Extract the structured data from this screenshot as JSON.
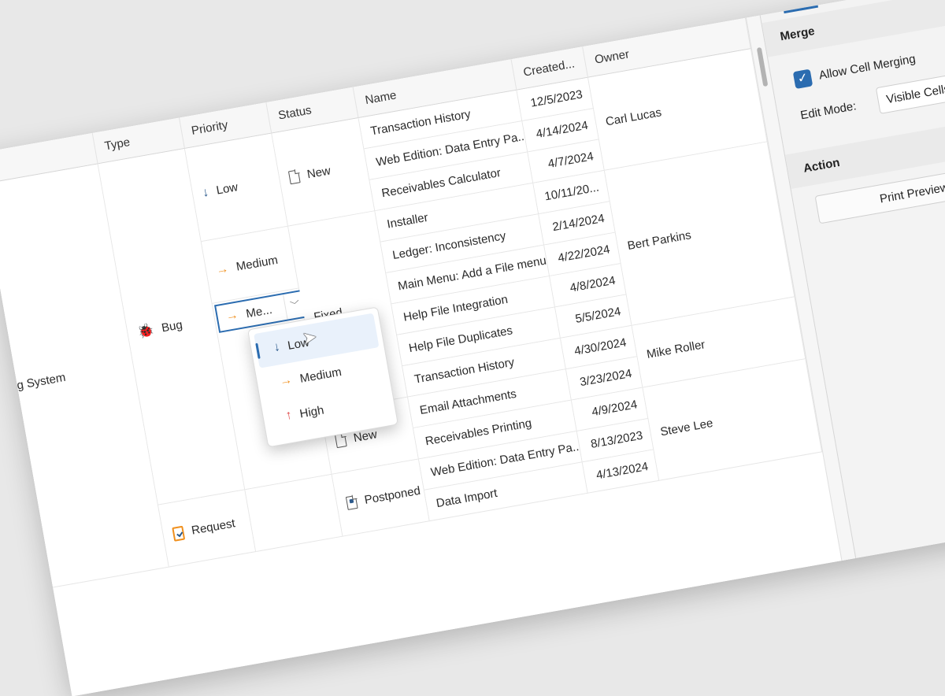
{
  "columns": {
    "project": "",
    "type": "Type",
    "priority": "Priority",
    "status": "Status",
    "name": "Name",
    "created": "Created...",
    "owner": "Owner"
  },
  "project_value": "Enterprise Accounting System",
  "types": {
    "bug": "Bug",
    "request": "Request"
  },
  "priority_labels": {
    "low": "Low",
    "medium": "Medium",
    "editor": "Me..."
  },
  "status_labels": {
    "new1": "New",
    "fixed": "Fixed",
    "new2": "New",
    "postponed": "Postponed"
  },
  "rows": [
    {
      "name": "Transaction History",
      "date": "12/5/2023"
    },
    {
      "name": "Web Edition: Data Entry Pa...",
      "date": "4/14/2024"
    },
    {
      "name": "Receivables Calculator",
      "date": "4/7/2024"
    },
    {
      "name": "Installer",
      "date": "10/11/20..."
    },
    {
      "name": "Ledger: Inconsistency",
      "date": "2/14/2024"
    },
    {
      "name": "Main Menu: Add a File menu",
      "date": "4/22/2024"
    },
    {
      "name": "Help File Integration",
      "date": "4/8/2024"
    },
    {
      "name": "Help File Duplicates",
      "date": "5/5/2024"
    },
    {
      "name": "Transaction History",
      "date": "4/30/2024"
    },
    {
      "name": "Email Attachments",
      "date": "3/23/2024"
    },
    {
      "name": "Receivables Printing",
      "date": "4/9/2024"
    },
    {
      "name": "Web Edition: Data Entry Pa...",
      "date": "8/13/2023"
    },
    {
      "name": "Data Import",
      "date": "4/13/2024"
    }
  ],
  "owners": {
    "carl": "Carl Lucas",
    "bert": "Bert Parkins",
    "mike": "Mike Roller",
    "steve": "Steve Lee"
  },
  "dropdown": [
    {
      "label": "Low"
    },
    {
      "label": "Medium"
    },
    {
      "label": "High"
    }
  ],
  "panel": {
    "merge_title": "Merge",
    "allow_cell_merging": "Allow Cell Merging",
    "edit_mode_label": "Edit Mode:",
    "edit_mode_value": "Visible Cells",
    "action_title": "Action",
    "print_preview": "Print Preview"
  },
  "colors": {
    "accent": "#2b6cb0",
    "medium": "#f0901e",
    "high": "#e04a4a",
    "low": "#2c5a8c"
  }
}
